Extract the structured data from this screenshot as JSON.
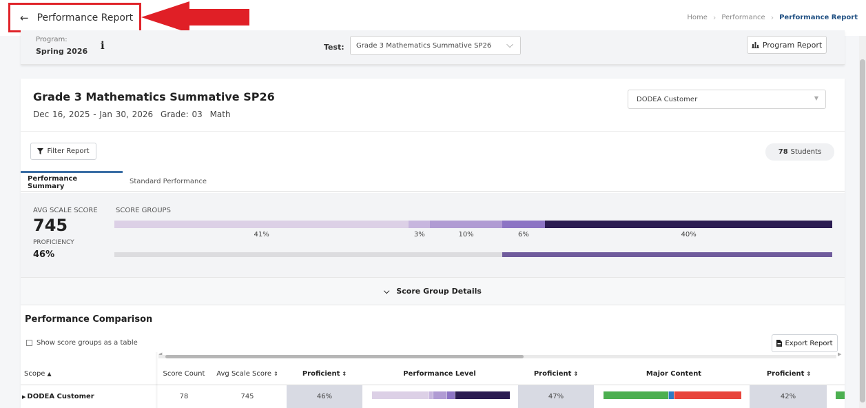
{
  "header": {
    "title": "Performance Report",
    "breadcrumbs": [
      "Home",
      "Performance",
      "Performance Report"
    ]
  },
  "program_bar": {
    "program_label": "Program:",
    "program_value": "Spring 2026",
    "test_label": "Test:",
    "test_value": "Grade 3 Mathematics Summative SP26",
    "program_report_label": "Program Report"
  },
  "report": {
    "title": "Grade 3 Mathematics Summative SP26",
    "dates": "Dec 16, 2025 - Jan 30, 2026",
    "grade": "Grade: 03",
    "subject": "Math",
    "customer": "DODEA Customer",
    "filter_label": "Filter Report",
    "students_count": "78",
    "students_label": "Students"
  },
  "tabs": [
    {
      "label": "Performance Summary",
      "active": true
    },
    {
      "label": "Standard Performance",
      "active": false
    }
  ],
  "summary": {
    "avg_label": "AVG SCALE SCORE",
    "avg_value": "745",
    "proficiency_label": "PROFICIENCY",
    "proficiency_value": "46%",
    "score_groups_label": "SCORE GROUPS",
    "proficiency_fraction": 0.46,
    "score_groups": [
      {
        "label": "41%",
        "value": 41,
        "color": "#dcd0e6"
      },
      {
        "label": "3%",
        "value": 3,
        "color": "#c7b6de"
      },
      {
        "label": "10%",
        "value": 10,
        "color": "#b09bd3"
      },
      {
        "label": "6%",
        "value": 6,
        "color": "#8c74c4"
      },
      {
        "label": "40%",
        "value": 40,
        "color": "#2b1c52"
      }
    ],
    "details_label": "Score Group Details"
  },
  "comparison": {
    "title": "Performance Comparison",
    "checkbox_label": "Show score groups as a table",
    "export_label": "Export Report",
    "columns": {
      "scope": "Scope",
      "score_count": "Score Count",
      "avg_scale_score": "Avg Scale Score",
      "proficient": "Proficient",
      "performance_level": "Performance Level",
      "major_content": "Major Content"
    },
    "rows": [
      {
        "scope": "DODEA Customer",
        "score_count": "78",
        "avg_scale_score": "745",
        "proficient_1": "46%",
        "proficient_2": "47%",
        "proficient_3": "42%"
      }
    ],
    "performance_level_bar": [
      {
        "value": 41,
        "color": "#dcd0e6"
      },
      {
        "value": 3,
        "color": "#c7b6de"
      },
      {
        "value": 10,
        "color": "#b09bd3"
      },
      {
        "value": 6,
        "color": "#8c74c4"
      },
      {
        "value": 40,
        "color": "#2b1c52"
      }
    ],
    "major_content_bar": [
      {
        "value": 47,
        "color": "#4caf50"
      },
      {
        "value": 4,
        "color": "#2e7bc4"
      },
      {
        "value": 49,
        "color": "#e8453c"
      }
    ],
    "next_column_color": "#4caf50"
  },
  "icons": {
    "back": "back-arrow-icon",
    "info": "info-icon",
    "chart": "bar-chart-icon",
    "filter": "filter-icon",
    "export": "file-icon"
  }
}
